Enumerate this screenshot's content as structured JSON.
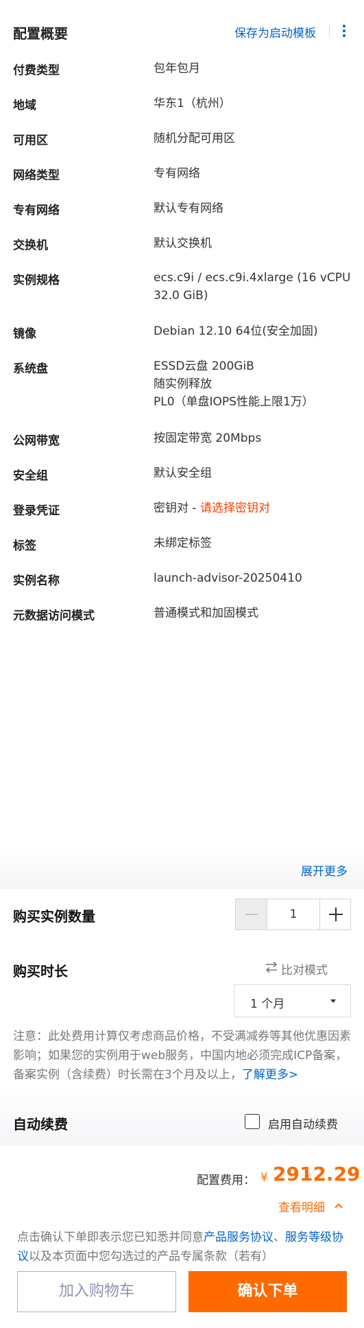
{
  "header": {
    "title": "配置概要",
    "save_template": "保存为启动模板",
    "more_icon": "more-vertical-icon"
  },
  "summary": {
    "rows": [
      {
        "label": "付费类型",
        "value": [
          "包年包月"
        ]
      },
      {
        "label": "地域",
        "value": [
          "华东1（杭州）"
        ]
      },
      {
        "label": "可用区",
        "value": [
          "随机分配可用区"
        ]
      },
      {
        "label": "网络类型",
        "value": [
          "专有网络"
        ]
      },
      {
        "label": "专有网络",
        "value": [
          "默认专有网络"
        ]
      },
      {
        "label": "交换机",
        "value": [
          "默认交换机"
        ]
      },
      {
        "label": "实例规格",
        "value": [
          "ecs.c9i / ecs.c9i.4xlarge (16 vCPU",
          "32.0 GiB)"
        ]
      },
      {
        "label": "镜像",
        "value": [
          "Debian 12.10 64位(安全加固)"
        ]
      },
      {
        "label": "系统盘",
        "value": [
          "ESSD云盘 200GiB",
          "随实例释放",
          "PL0（单盘IOPS性能上限1万）"
        ]
      },
      {
        "label": "公网带宽",
        "value": [
          "按固定带宽 20Mbps"
        ]
      },
      {
        "label": "安全组",
        "value": [
          "默认安全组"
        ]
      },
      {
        "label": "登录凭证",
        "value": [
          "密钥对 - "
        ],
        "link": "请选择密钥对"
      },
      {
        "label": "标签",
        "value": [
          "未绑定标签"
        ]
      },
      {
        "label": "实例名称",
        "value": [
          "launch-advisor-20250410"
        ]
      },
      {
        "label": "元数据访问模式",
        "value": [
          "普通模式和加固模式"
        ]
      }
    ],
    "expand_more": "展开更多"
  },
  "purchase": {
    "quantity_title": "购买实例数量",
    "quantity": "1",
    "duration_title": "购买时长",
    "compare_mode": "比对模式",
    "compare_icon": "swap-arrows-icon",
    "duration_selected": "1 个月",
    "notice_text": "注意：此处费用计算仅考虑商品价格，不受满减券等其他优惠因素影响；如果您的实例用于web服务，中国内地必须完成ICP备案，备案实例（含续费）时长需在3个月及以上，",
    "notice_link": "了解更多>",
    "auto_renew_title": "自动续费",
    "auto_renew_label": "启用自动续费",
    "auto_renew_checked": false
  },
  "footer": {
    "fee_label": "配置费用：",
    "currency": "¥",
    "fee_amount": "2912.29",
    "detail_link": "查看明细",
    "agreement_prefix": "点击确认下单即表示您已知悉并同意",
    "agreement_link1": "产品服务协议",
    "agreement_sep": "、",
    "agreement_link2": "服务等级协议",
    "agreement_suffix": "以及本页面中您勾选过的产品专属条款（若有）",
    "add_cart": "加入购物车",
    "confirm_order": "确认下单"
  },
  "colors": {
    "brand_blue": "#0064c8",
    "accent_orange": "#ff6a00",
    "alert_red": "#ff3d00"
  }
}
